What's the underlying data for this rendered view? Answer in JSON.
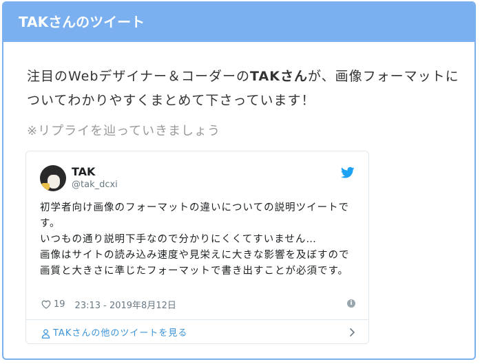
{
  "card": {
    "header_title": "TAKさんのツイート",
    "intro_part1": "注目のWebデザイナー＆コーダーの",
    "intro_bold": "TAKさん",
    "intro_part2": "が、画像フォーマットについてわかりやすくまとめて下さっています！",
    "hint": "※リプライを辿っていきましょう"
  },
  "tweet": {
    "name": "TAK",
    "handle": "@tak_dcxi",
    "text_line1": "初学者向け画像のフォーマットの違いについての説明ツイートです。",
    "text_line2": "いつもの通り説明下手なので分かりにくくてすいません…",
    "text_line3": "画像はサイトの読み込み速度や見栄えに大きな影響を及ぼすので画質と大きさに準じたフォーマットで書き出すことが必須です。",
    "likes": "19",
    "datetime": "23:13 - 2019年8月12日",
    "more_label": "TAKさんの他のツイートを見る"
  },
  "icons": {
    "bird": "twitter-bird-icon",
    "heart": "heart-icon",
    "info": "info-icon",
    "person": "person-icon",
    "chevron": "chevron-right-icon"
  },
  "colors": {
    "header_bg": "#7ab0ef",
    "link": "#3b94d9",
    "twitter_blue": "#1da1f2"
  }
}
